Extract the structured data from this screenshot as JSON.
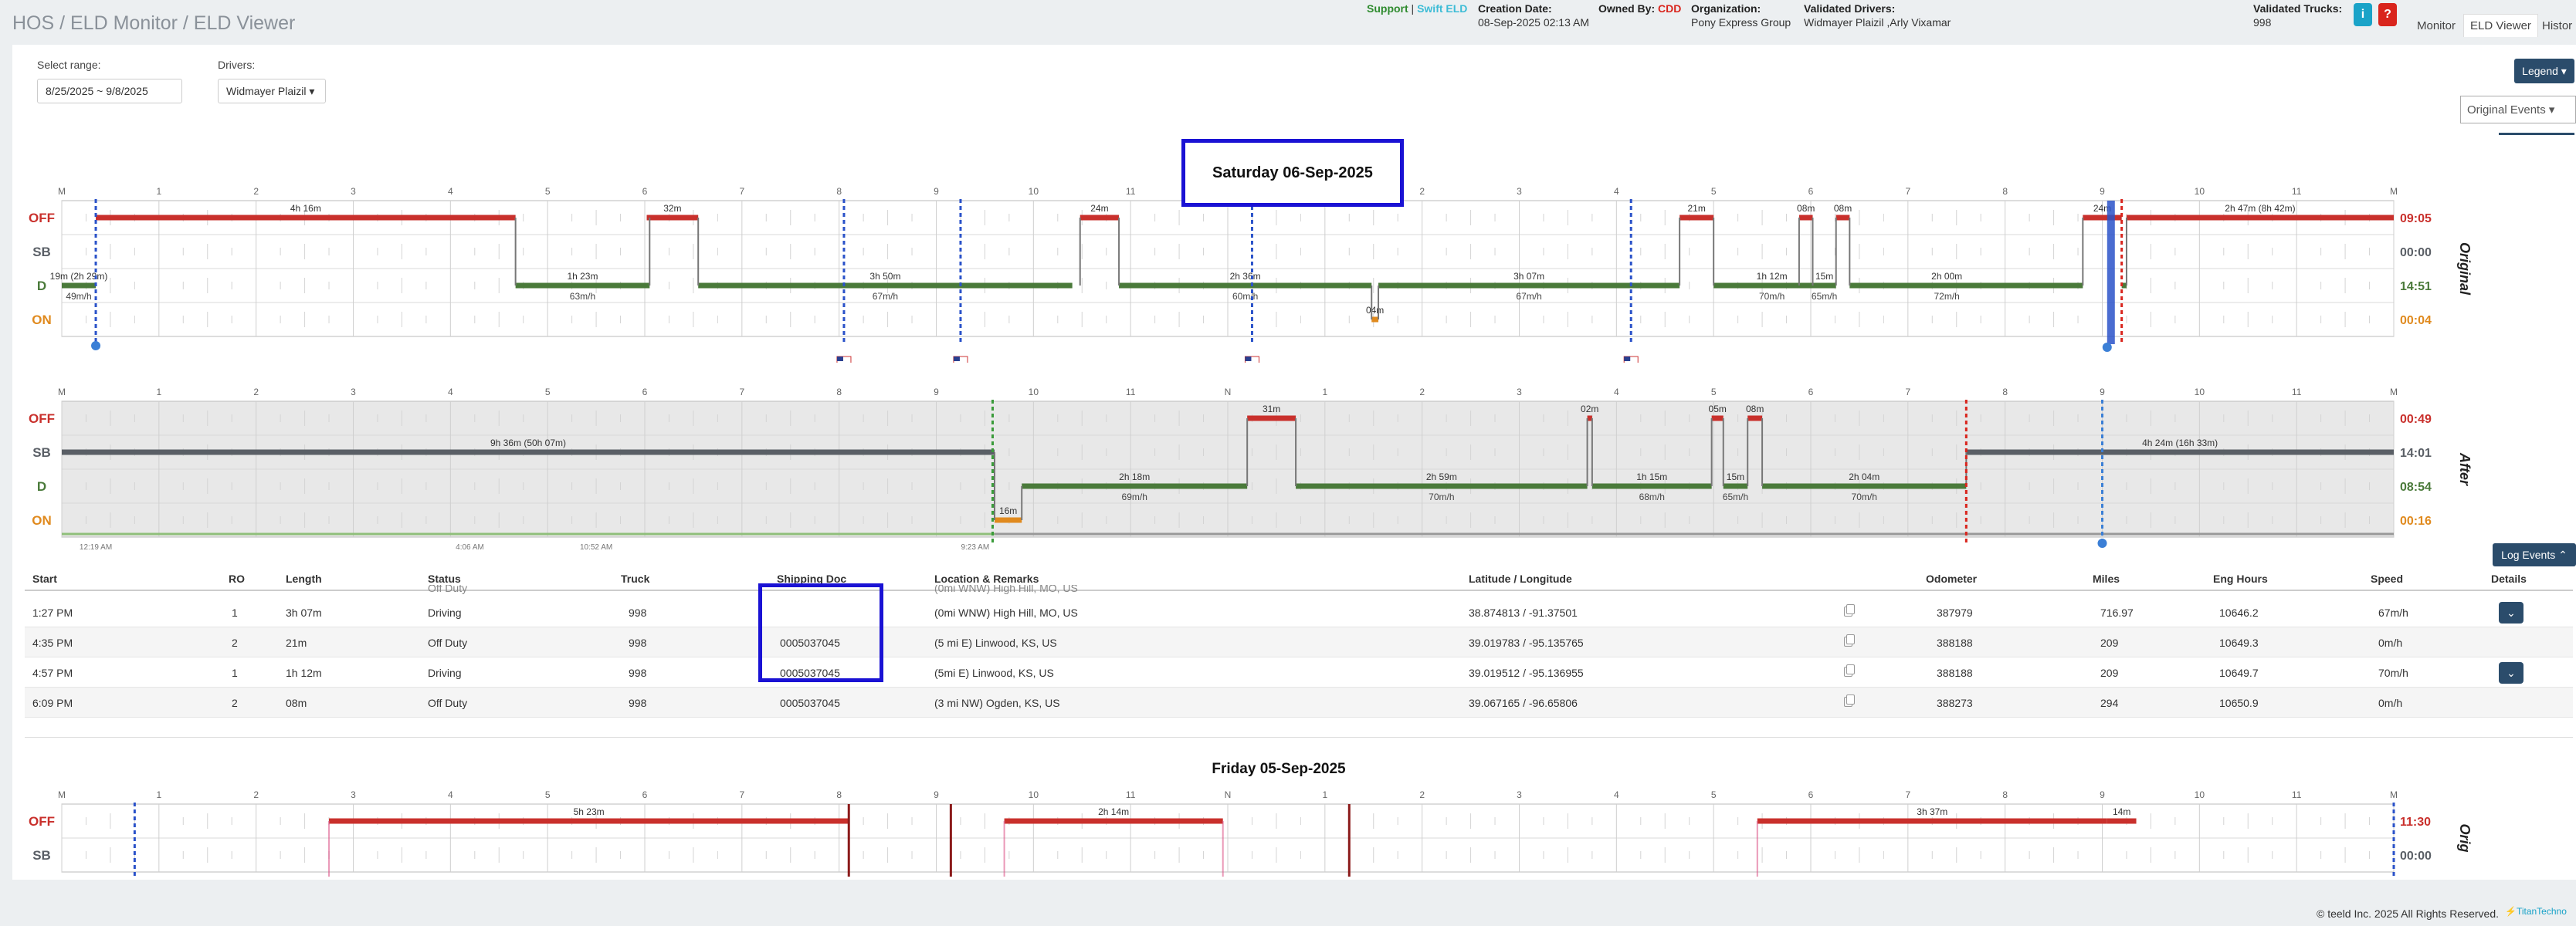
{
  "breadcrumb": "HOS / ELD Monitor / ELD Viewer",
  "header": {
    "support": "Support",
    "sep": " | ",
    "swift": "Swift ELD",
    "creation_label": "Creation Date:",
    "creation_value": "08-Sep-2025 02:13 AM",
    "owned_label": "Owned By:",
    "owned_value": "CDD",
    "org_label": "Organization:",
    "org_value": "Pony Express Group",
    "vdrivers_label": "Validated Drivers:",
    "vdrivers_value": "Widmayer Plaizil ,Arly Vixamar",
    "vtrucks_label": "Validated Trucks:",
    "vtrucks_value": "998",
    "info_btn": "i",
    "help_btn": "?"
  },
  "nav_tabs": [
    "Monitor",
    "ELD Viewer",
    "Histor"
  ],
  "filters": {
    "range_label": "Select range:",
    "range_value": "8/25/2025 ~ 9/8/2025",
    "drivers_label": "Drivers:",
    "drivers_value": "Widmayer Plaizil"
  },
  "legend_btn": "Legend",
  "original_select": "Original Events",
  "log_events_btn": "Log Events",
  "hours": [
    "M",
    "1",
    "2",
    "3",
    "4",
    "5",
    "6",
    "7",
    "8",
    "9",
    "10",
    "11",
    "N",
    "1",
    "2",
    "3",
    "4",
    "5",
    "6",
    "7",
    "8",
    "9",
    "10",
    "11",
    "M"
  ],
  "status_labels": [
    "OFF",
    "SB",
    "D",
    "ON"
  ],
  "chart1": {
    "title": "Saturday 06-Sep-2025",
    "side_label": "Original",
    "totals": [
      "09:05",
      "00:00",
      "14:51",
      "00:04"
    ],
    "segments": [
      "4h 16m",
      "32m",
      "24m",
      "21m",
      "08m",
      "08m",
      "24m",
      "2h 47m (8h 42m)",
      "1h 23m",
      "3h 50m",
      "2h 36m",
      "3h 07m",
      "1h 12m",
      "15m",
      "2h 00m",
      "04m",
      "19m (2h 29m)"
    ],
    "speeds": [
      "49m/h",
      "63m/h",
      "67m/h",
      "60m/h",
      "67m/h",
      "70m/h",
      "65m/h",
      "72m/h"
    ],
    "pct_label": "4m"
  },
  "chart2": {
    "side_label": "After",
    "totals": [
      "00:49",
      "14:01",
      "08:54",
      "00:16"
    ],
    "segments": [
      "9h 36m (50h 07m)",
      "31m",
      "02m",
      "05m",
      "08m",
      "4h 24m (16h 33m)",
      "2h 18m",
      "2h 59m",
      "1h 15m",
      "15m",
      "2h 04m",
      "16m"
    ],
    "speeds": [
      "69m/h",
      "70m/h",
      "68m/h",
      "65m/h",
      "70m/h"
    ],
    "times": [
      "12:19 AM",
      "4:06 AM",
      "10:52 AM",
      "9:23 AM"
    ]
  },
  "table": {
    "headers": [
      "Start",
      "RO",
      "Length",
      "Status",
      "Truck",
      "Shipping Doc",
      "Location & Remarks",
      "Latitude / Longitude",
      "Odometer",
      "Miles",
      "Eng Hours",
      "Speed",
      "Details"
    ],
    "partial_top": [
      "Off Duty",
      "(0mi WNW) High Hill, MO, US"
    ],
    "rows": [
      {
        "start": "1:27 PM",
        "ro": "1",
        "length": "3h 07m",
        "status": "Driving",
        "truck": "998",
        "doc": "",
        "loc": "(0mi WNW) High Hill, MO, US",
        "latlon": "38.874813 / -91.37501",
        "odo": "387979",
        "miles": "716.97",
        "eng": "10646.2",
        "speed": "67m/h"
      },
      {
        "start": "4:35 PM",
        "ro": "2",
        "length": "21m",
        "status": "Off Duty",
        "truck": "998",
        "doc": "0005037045",
        "loc": "(5 mi E) Linwood, KS, US",
        "latlon": "39.019783 / -95.135765",
        "odo": "388188",
        "miles": "209",
        "eng": "10649.3",
        "speed": "0m/h"
      },
      {
        "start": "4:57 PM",
        "ro": "1",
        "length": "1h 12m",
        "status": "Driving",
        "truck": "998",
        "doc": "0005037045",
        "loc": "(5mi E) Linwood, KS, US",
        "latlon": "39.019512 / -95.136955",
        "odo": "388188",
        "miles": "209",
        "eng": "10649.7",
        "speed": "70m/h"
      },
      {
        "start": "6:09 PM",
        "ro": "2",
        "length": "08m",
        "status": "Off Duty",
        "truck": "998",
        "doc": "0005037045",
        "loc": "(3 mi NW) Ogden, KS, US",
        "latlon": "39.067165 / -96.65806",
        "odo": "388273",
        "miles": "294",
        "eng": "10650.9",
        "speed": "0m/h"
      }
    ]
  },
  "chart3": {
    "title": "Friday 05-Sep-2025",
    "side_label": "Orig",
    "totals": [
      "11:30",
      "00:00"
    ],
    "segments": [
      "5h 23m",
      "2h 14m",
      "3h 37m",
      "14m"
    ]
  },
  "footer": {
    "copyright": "© teeld Inc. 2025 All Rights Reserved.",
    "brand": "TitanTechno"
  },
  "colors": {
    "off": "#c9302c",
    "sb": "#5a5f66",
    "drive": "#4a7a3a",
    "on": "#e08a1e",
    "dark": "#2b4c6b",
    "box": "#1a12d4"
  }
}
